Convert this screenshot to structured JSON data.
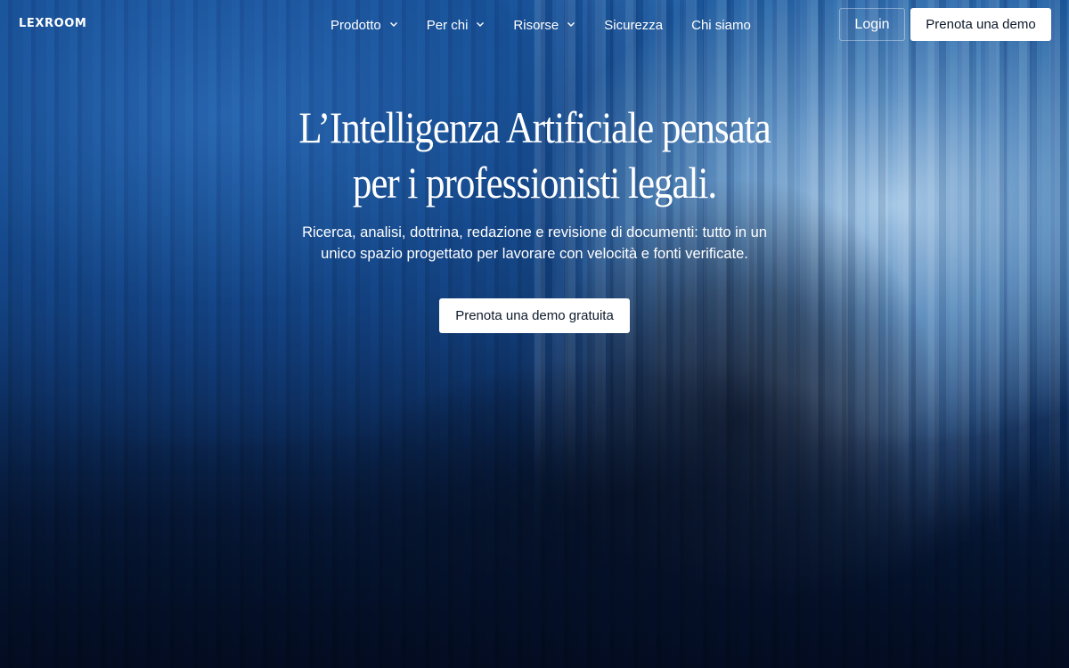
{
  "brand": {
    "logo_text": "LEXROOM"
  },
  "nav": {
    "items": [
      {
        "label": "Prodotto",
        "has_dropdown": true
      },
      {
        "label": "Per chi",
        "has_dropdown": true
      },
      {
        "label": "Risorse",
        "has_dropdown": true
      },
      {
        "label": "Sicurezza",
        "has_dropdown": false
      },
      {
        "label": "Chi siamo",
        "has_dropdown": false
      }
    ],
    "dropdown_icon": "chevron-down-icon"
  },
  "header_actions": {
    "login_label": "Login",
    "demo_label": "Prenota una demo"
  },
  "hero": {
    "title_line1": "L’Intelligenza Artificiale pensata",
    "title_line2": "per i professionisti legali.",
    "subtitle_line1": "Ricerca, analisi, dottrina, redazione e revisione di documenti: tutto in un",
    "subtitle_line2": "unico spazio progettato per lavorare con velocità e fonti verificate.",
    "cta_label": "Prenota una demo gratuita"
  },
  "colors": {
    "background_top": "#1c5aa0",
    "background_bottom": "#041330",
    "button_bg": "#ffffff",
    "button_text": "#0d1a2b",
    "text": "#ffffff"
  }
}
